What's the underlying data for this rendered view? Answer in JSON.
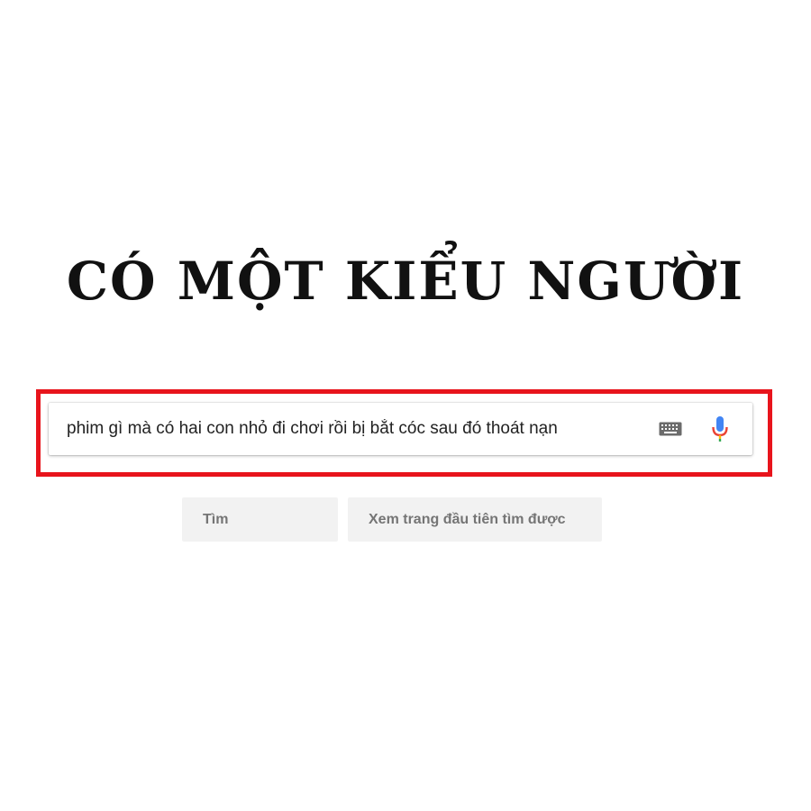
{
  "headline": "CÓ MỘT KIỂU NGƯỜI",
  "search": {
    "query": "phim gì mà có hai con nhỏ đi chơi rồi bị bắt cóc sau đó thoát nạn",
    "keyboard_icon": "keyboard-icon",
    "mic_icon": "microphone-icon"
  },
  "buttons": {
    "search_label": "Tìm",
    "lucky_label": "Xem trang đầu tiên tìm được"
  },
  "colors": {
    "highlight_border": "#e8141c",
    "button_bg": "#f2f2f2",
    "button_text": "#757575"
  }
}
